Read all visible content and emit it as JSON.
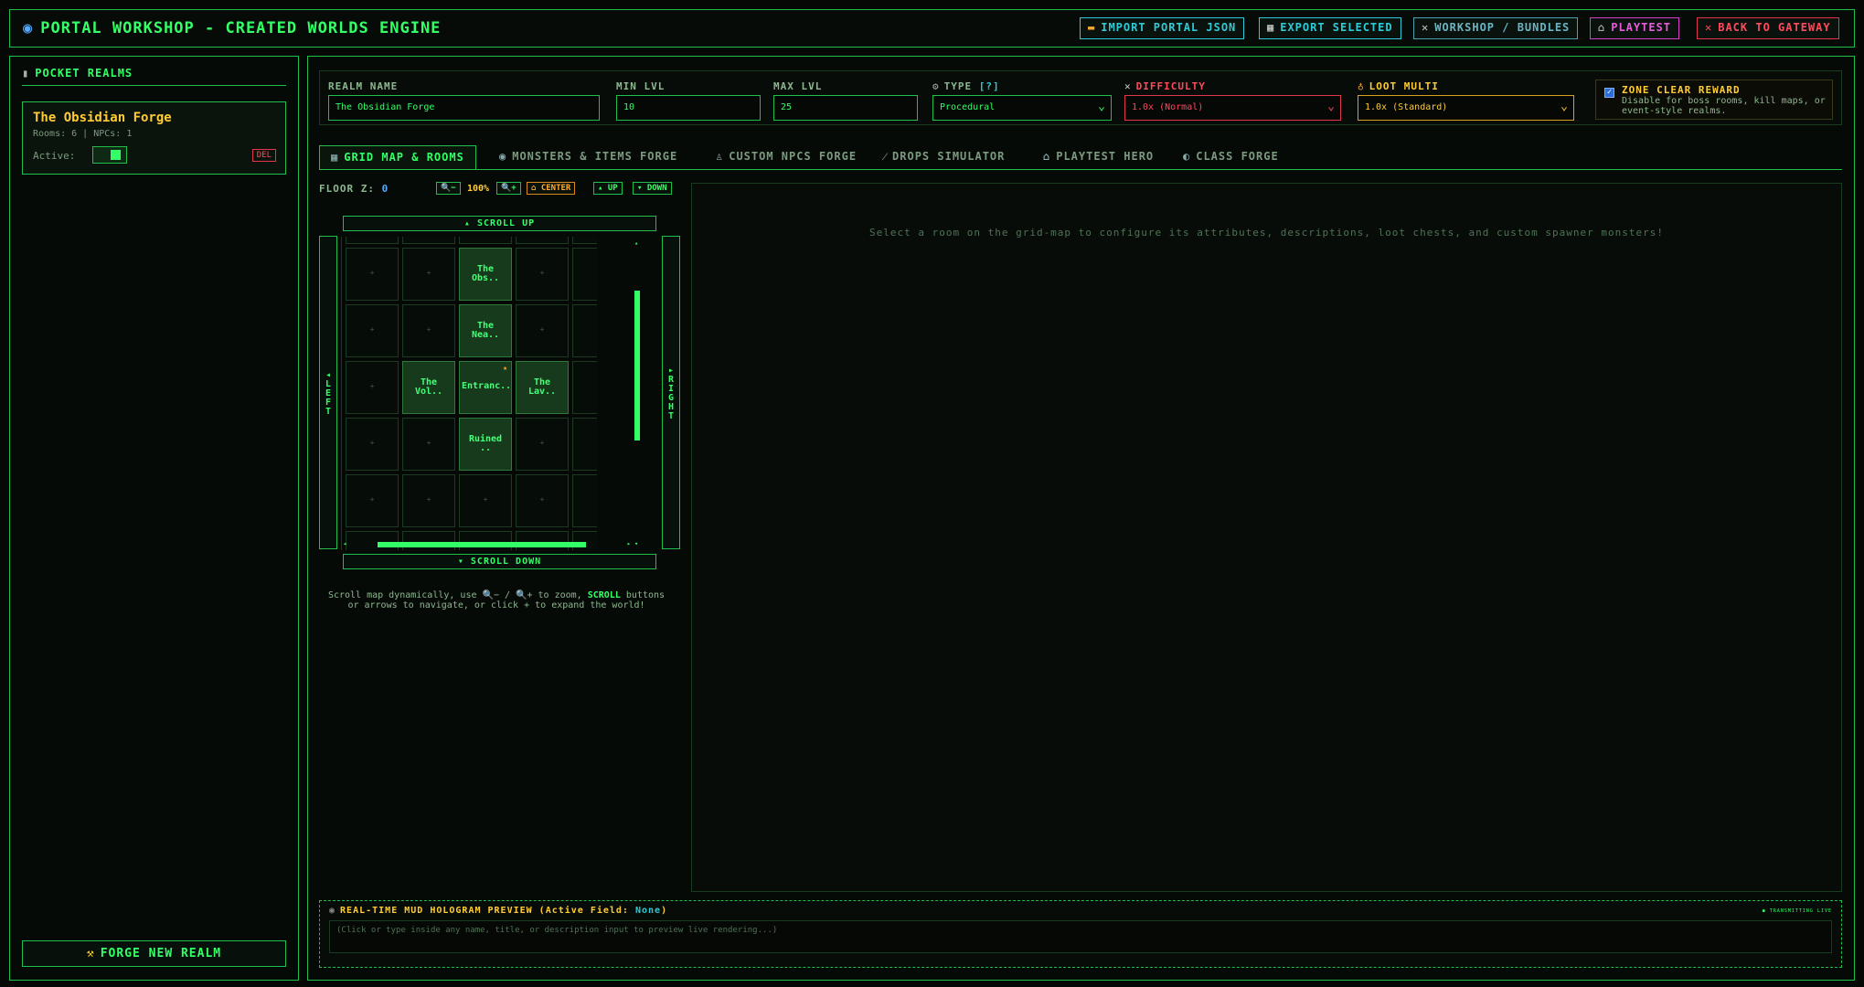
{
  "header": {
    "title": "PORTAL WORKSHOP - CREATED WORLDS ENGINE",
    "buttons": {
      "import": "IMPORT PORTAL JSON",
      "export": "EXPORT SELECTED",
      "workshop": "WORKSHOP / BUNDLES",
      "playtest": "PLAYTEST",
      "back": "BACK TO GATEWAY"
    }
  },
  "sidebar": {
    "heading": "POCKET REALMS",
    "realm": {
      "name": "The Obsidian Forge",
      "meta": "Rooms: 6 | NPCs: 1",
      "active_label": "Active:",
      "active": true,
      "delete_label": "DEL"
    },
    "forge_button": "FORGE NEW REALM"
  },
  "fields": {
    "realm_name_label": "REALM NAME",
    "realm_name_value": "The Obsidian Forge",
    "min_lvl_label": "MIN LVL",
    "min_lvl_value": "10",
    "max_lvl_label": "MAX LVL",
    "max_lvl_value": "25",
    "type_label": "TYPE",
    "type_hint": "[?]",
    "type_value": "Procedural",
    "difficulty_label": "DIFFICULTY",
    "difficulty_value": "1.0x (Normal)",
    "loot_label": "LOOT MULTI",
    "loot_value": "1.0x (Standard)",
    "zone_title": "ZONE CLEAR REWARD",
    "zone_desc": "Disable for boss rooms, kill maps, or event-style realms.",
    "zone_checked": true
  },
  "tabs": [
    {
      "label": "GRID MAP & ROOMS",
      "active": true
    },
    {
      "label": "MONSTERS & ITEMS FORGE",
      "active": false
    },
    {
      "label": "CUSTOM NPCS FORGE",
      "active": false
    },
    {
      "label": "DROPS SIMULATOR",
      "active": false
    },
    {
      "label": "PLAYTEST HERO",
      "active": false
    },
    {
      "label": "CLASS FORGE",
      "active": false
    }
  ],
  "map": {
    "floor_label": "FLOOR Z:",
    "floor_value": "0",
    "zoom_out": "🔍−",
    "zoom_value": "100%",
    "zoom_in": "🔍+",
    "center": "CENTER",
    "up": "UP",
    "down": "DOWN",
    "scroll_up": "SCROLL UP",
    "scroll_down": "SCROLL DOWN",
    "left": "LEFT",
    "right": "RIGHT",
    "rooms": {
      "obs": "The Obs..",
      "nea": "The Nea..",
      "vol": "The Vol..",
      "entrance": "Entranc..",
      "lav": "The Lav..",
      "ruined": "Ruined .."
    },
    "help_before": "Scroll map dynamically, use 🔍− / 🔍+ to zoom,",
    "help_scroll": "SCROLL",
    "help_after": "buttons or arrows to navigate, or click + to expand the world!"
  },
  "detail": {
    "message": "Select a room on the grid-map to configure its attributes, descriptions, loot chests, and custom spawner monsters!"
  },
  "hologram": {
    "title_prefix": "REAL-TIME MUD HOLOGRAM PREVIEW (Active Field:",
    "active_field": "None",
    "title_suffix": ")",
    "live": "● TRANSMITTING LIVE",
    "placeholder": "(Click or type inside any name, title, or description input to preview live rendering...)"
  },
  "colors": {
    "accent": "#33ff66",
    "gold": "#ffcc33",
    "cyan": "#2ecbd6",
    "red": "#ff4a5c",
    "magenta": "#ea5adc"
  }
}
